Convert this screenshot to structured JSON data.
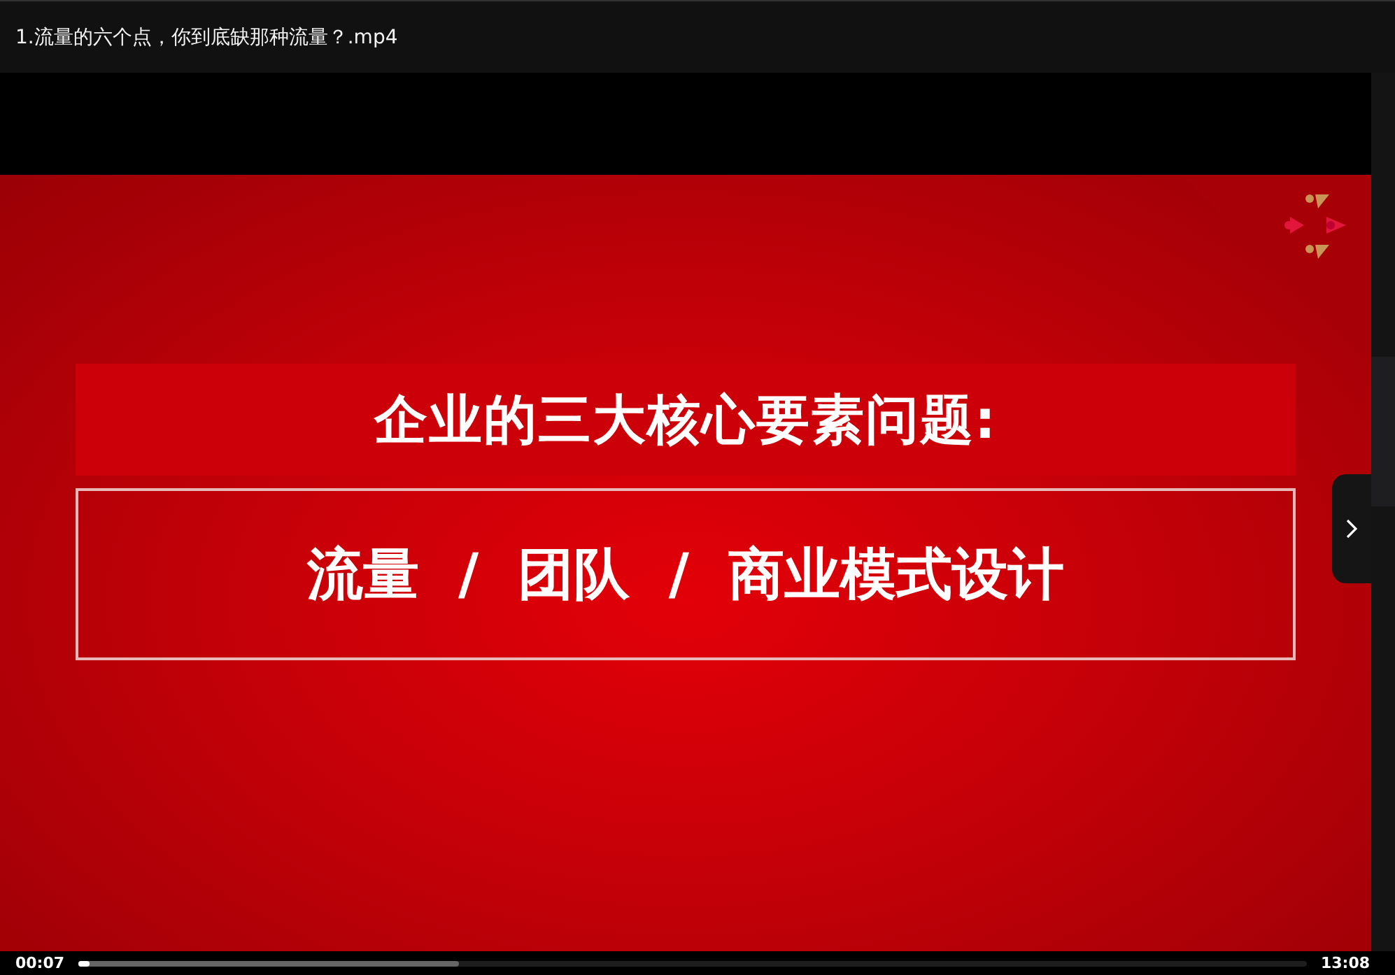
{
  "window": {
    "title": "1.流量的六个点，你到底缺那种流量？.mp4"
  },
  "slide": {
    "heading": "企业的三大核心要素问题:",
    "topics": "流量  /  团队  /  商业模式设计"
  },
  "player": {
    "current_time": "00:07",
    "duration": "13:08",
    "progress": {
      "level": 0.009
    },
    "buffer": {
      "level": 0.31
    }
  }
}
